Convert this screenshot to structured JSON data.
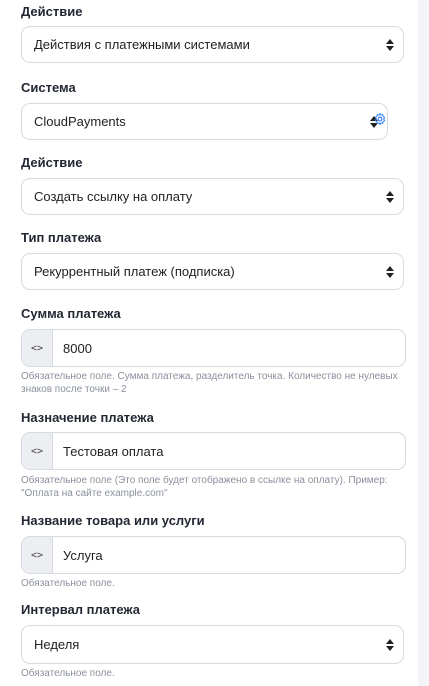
{
  "fields": {
    "action_group": {
      "label": "Действие",
      "value": "Действия с платежными системами"
    },
    "system": {
      "label": "Система",
      "value": "CloudPayments"
    },
    "action": {
      "label": "Действие",
      "value": "Создать ссылку на оплату"
    },
    "payment_type": {
      "label": "Тип платежа",
      "value": "Рекуррентный платеж (подписка)"
    },
    "amount": {
      "label": "Сумма платежа",
      "prefix": "<>",
      "value": "8000",
      "help": "Обязательное поле. Сумма платежа, разделитель точка. Количество не нулевых знаков после точки – 2"
    },
    "purpose": {
      "label": "Назначение платежа",
      "prefix": "<>",
      "value": "Тестовая оплата",
      "help": "Обязательное поле (Это поле будет отображено в ссылке на оплату). Пример: \"Оплата на сайте example.com\""
    },
    "product": {
      "label": "Название товара или услуги",
      "prefix": "<>",
      "value": "Услуга",
      "help": "Обязательное поле."
    },
    "interval": {
      "label": "Интервал платежа",
      "value": "Неделя",
      "help": "Обязательное поле."
    }
  },
  "colors": {
    "accent": "#3b82f6",
    "border": "#d6dae1",
    "help_text": "#8a919c"
  },
  "icons": {
    "system_settings": "gear-icon",
    "select_arrows": "sort-arrows-icon"
  }
}
